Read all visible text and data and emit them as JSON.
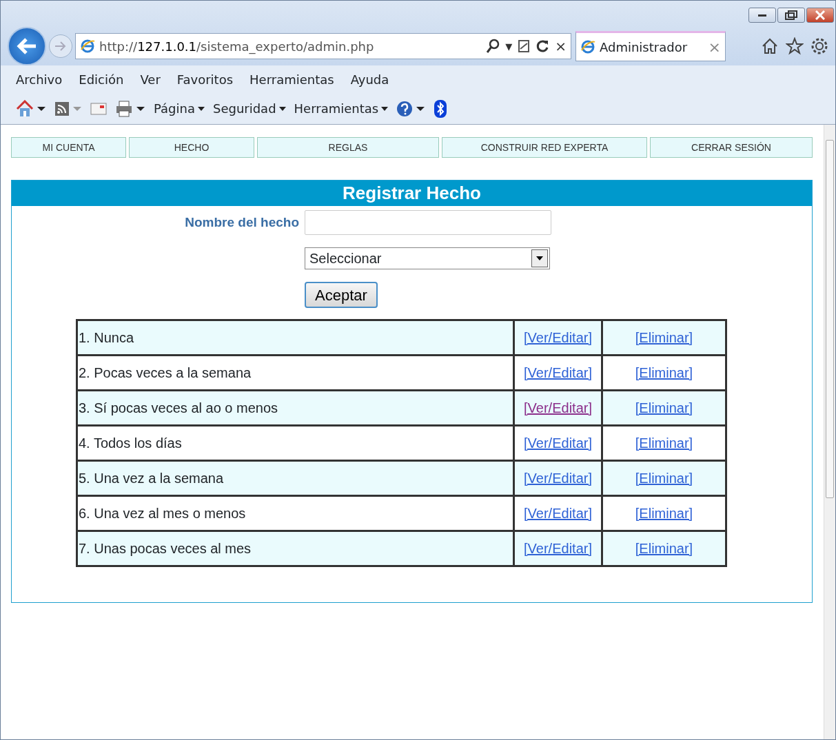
{
  "browser": {
    "address_prefix": "http://",
    "address_host": "127.1.0.1",
    "address_path": "/sistema_experto/admin.php",
    "tab": {
      "title": "Administrador",
      "close": "×"
    },
    "address_buttons": [
      "▾",
      "×"
    ],
    "menu": [
      "Archivo",
      "Edición",
      "Ver",
      "Favoritos",
      "Herramientas",
      "Ayuda"
    ],
    "commands": [
      "Página",
      "Seguridad",
      "Herramientas"
    ]
  },
  "nav": [
    "MI CUENTA",
    "HECHO",
    "REGLAS",
    "CONSTRUIR RED EXPERTA",
    "CERRAR SESIÓN"
  ],
  "panel": {
    "title": "Registrar Hecho",
    "name_label": "Nombre del hecho",
    "select_value": "Seleccionar",
    "submit": "Aceptar"
  },
  "rows": [
    {
      "text": "1. Nunca",
      "edit": "[Ver/Editar]",
      "edit_visited": false,
      "delete": "[Eliminar]"
    },
    {
      "text": "2. Pocas veces a la semana",
      "edit": "[Ver/Editar]",
      "edit_visited": false,
      "delete": "[Eliminar]"
    },
    {
      "text": "3. Sí pocas veces al ao o menos",
      "edit": "[Ver/Editar]",
      "edit_visited": true,
      "delete": "[Eliminar]"
    },
    {
      "text": "4. Todos los días",
      "edit": "[Ver/Editar]",
      "edit_visited": false,
      "delete": "[Eliminar]"
    },
    {
      "text": "5. Una vez a la semana",
      "edit": "[Ver/Editar]",
      "edit_visited": false,
      "delete": "[Eliminar]"
    },
    {
      "text": "6. Una vez al mes o menos",
      "edit": "[Ver/Editar]",
      "edit_visited": false,
      "delete": "[Eliminar]"
    },
    {
      "text": "7. Unas pocas veces al mes",
      "edit": "[Ver/Editar]",
      "edit_visited": false,
      "delete": "[Eliminar]"
    }
  ]
}
